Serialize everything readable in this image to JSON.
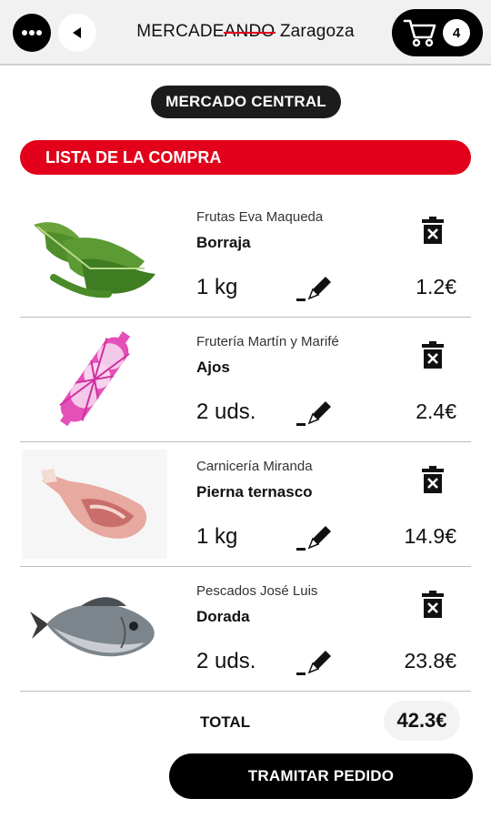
{
  "header": {
    "title_prefix": "MERCADE",
    "title_struck": "ANDO",
    "title_suffix": " Zaragoza",
    "cart_count": "4",
    "icons": [
      "more-dots-icon",
      "back-arrow-icon",
      "cart-icon"
    ]
  },
  "market": {
    "name": "MERCADO CENTRAL"
  },
  "section": {
    "title": "LISTA DE LA COMPRA"
  },
  "items": [
    {
      "vendor": "Frutas Eva Maqueda",
      "product": "Borraja",
      "quantity": "1 kg",
      "price": "1.2€"
    },
    {
      "vendor": "Frutería Martín y Marifé",
      "product": "Ajos",
      "quantity": "2 uds.",
      "price": "2.4€"
    },
    {
      "vendor": "Carnicería Miranda",
      "product": "Pierna ternasco",
      "quantity": "1 kg",
      "price": "14.9€"
    },
    {
      "vendor": "Pescados José Luis",
      "product": "Dorada",
      "quantity": "2 uds.",
      "price": "23.8€"
    }
  ],
  "totals": {
    "label": "TOTAL",
    "value": "42.3€"
  },
  "actions": {
    "submit_label": "TRAMITAR PEDIDO"
  },
  "colors": {
    "accent": "#e2001a",
    "dark": "#000000",
    "header_bg": "#f1f1f1"
  }
}
